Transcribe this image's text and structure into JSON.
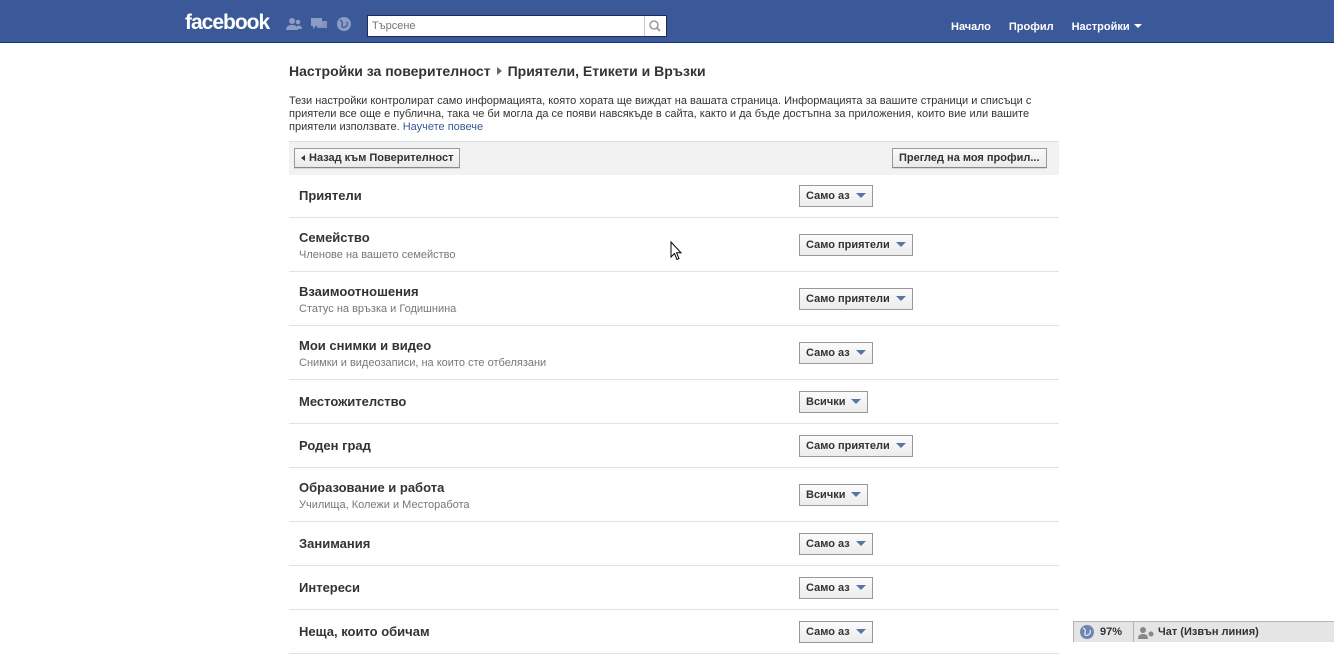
{
  "header": {
    "logo": "facebook",
    "search_placeholder": "Търсене",
    "nav": {
      "home": "Начало",
      "profile": "Профил",
      "settings": "Настройки"
    }
  },
  "breadcrumb": {
    "parent": "Настройки за поверителност",
    "current": "Приятели, Етикети и Връзки"
  },
  "intro": {
    "text": "Тези настройки контролират само информацията, която хората ще виждат на вашата страница. Информацията за вашите страници и списъци с приятели все още е публична, така че би могла да се появи навсякъде в сайта, както и да бъде достъпна за приложения, които вие или вашите приятели използвате.",
    "link": "Научете повече"
  },
  "toolbar": {
    "back": "Назад към Поверителност",
    "preview": "Преглед на моя профил..."
  },
  "settings": [
    {
      "title": "Приятели",
      "sub": "",
      "value": "Само аз"
    },
    {
      "title": "Семейство",
      "sub": "Членове на вашето семейство",
      "value": "Само приятели"
    },
    {
      "title": "Взаимоотношения",
      "sub": "Статус на връзка и Годишнина",
      "value": "Само приятели"
    },
    {
      "title": "Мои снимки и видео",
      "sub": "Снимки и видеозаписи, на които сте отбелязани",
      "value": "Само аз"
    },
    {
      "title": "Местожителство",
      "sub": "",
      "value": "Всички"
    },
    {
      "title": "Роден град",
      "sub": "",
      "value": "Само приятели"
    },
    {
      "title": "Образование и работа",
      "sub": "Училища, Колежи и Месторабота",
      "value": "Всички"
    },
    {
      "title": "Занимания",
      "sub": "",
      "value": "Само аз"
    },
    {
      "title": "Интереси",
      "sub": "",
      "value": "Само аз"
    },
    {
      "title": "Неща, които обичам",
      "sub": "",
      "value": "Само аз"
    }
  ],
  "chat": {
    "status": "97%",
    "label": "Чат (Извън линия)"
  },
  "colors": {
    "brand": "#3b5998",
    "link": "#3b5998",
    "caret": "#5b74a8"
  }
}
